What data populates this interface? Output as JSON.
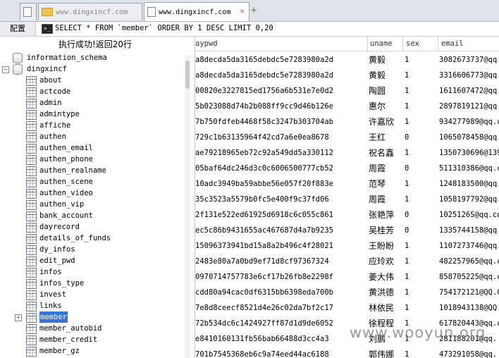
{
  "tabs": [
    {
      "label": "www.dingxincf.com",
      "active": false
    },
    {
      "label": "www.dingxincf.com",
      "active": true
    }
  ],
  "toolbar": {
    "config_label": "配置",
    "sql": "SELECT * FROM `member` ORDER BY 1 DESC LIMIT 0,20"
  },
  "left_panel": {
    "status": "执行成功!返回20行",
    "databases": [
      "information_schema",
      "dingxincf"
    ],
    "tables": [
      "about",
      "actcode",
      "admin",
      "admintype",
      "affiche",
      "authen",
      "authen_email",
      "authen_phone",
      "authen_realname",
      "authen_scene",
      "authen_video",
      "authen_vip",
      "bank_account",
      "dayrecord",
      "details_of_funds",
      "dy_infos",
      "edit_pwd",
      "infos",
      "infos_type",
      "invest",
      "links",
      "member",
      "member_autobid",
      "member_credit",
      "member_gz"
    ],
    "selected_table": "member"
  },
  "grid": {
    "columns": [
      "aypwd",
      "uname",
      "sex",
      "email"
    ],
    "rows": [
      {
        "pwd": "a8decda5da3165debdc5e7283980a2d",
        "uname": "黄毅",
        "sex": "1",
        "email": "3082673737@qq."
      },
      {
        "pwd": "a8decda5da3165debdc5e7283980a2d",
        "uname": "黄毅",
        "sex": "1",
        "email": "3316606773@qq."
      },
      {
        "pwd": "00820e3227815ed1756a6b531e7e0d2",
        "uname": "陶圆",
        "sex": "1",
        "email": "1611607472@qq."
      },
      {
        "pwd": "5b023088d74b2b088ff9cc9d46b126e",
        "uname": "惠尔",
        "sex": "1",
        "email": "2897819121@qq.c"
      },
      {
        "pwd": "7b750fdfeb4468f58c3247b303704ab",
        "uname": "许嘉欣",
        "sex": "1",
        "email": "934277989@qq.c"
      },
      {
        "pwd": "729c1b63135964f42cd7a6e0ea8678",
        "uname": "王红",
        "sex": "0",
        "email": "1065078458@qq."
      },
      {
        "pwd": "ae79218965eb72c92a549dd5a330112",
        "uname": "祝名鑫",
        "sex": "1",
        "email": "1350730696@139"
      },
      {
        "pwd": "05baf64dc246d3c0c6006500777cb52",
        "uname": "周霞",
        "sex": "0",
        "email": "511310386@qq.c"
      },
      {
        "pwd": "10adc3949ba59abbe56e057f20f883e",
        "uname": "范琴",
        "sex": "1",
        "email": "1248183500@qq."
      },
      {
        "pwd": "35c3523a5579b0fc5e400f9c37fd06",
        "uname": "周霞",
        "sex": "1",
        "email": "1058197792@qq."
      },
      {
        "pwd": "2f131e522ed61925d6918c6c055c861",
        "uname": "张艳萍",
        "sex": "0",
        "email": "1025126S@qq.com"
      },
      {
        "pwd": "ec5c86b9431655ac467687d4a7b9235",
        "uname": "吴桂芳",
        "sex": "0",
        "email": "1335744158@qq."
      },
      {
        "pwd": "15096373941bd15a8a2b496c4f28021",
        "uname": "王盼盼",
        "sex": "1",
        "email": "1107273746@qq."
      },
      {
        "pwd": "2483e80a7a0bd9ef71d8cf97367324",
        "uname": "应玲欢",
        "sex": "1",
        "email": "482257965@qq.c"
      },
      {
        "pwd": "0970714757783e6cf17b26fb8e2298f",
        "uname": "姜大伟",
        "sex": "1",
        "email": "858705225@qq.c"
      },
      {
        "pwd": "cdd80a94cac0df6315bb6398eda700b",
        "uname": "黄洪德",
        "sex": "1",
        "email": "754172121@QQ.C"
      },
      {
        "pwd": "7e8d8ceecf8521d4e26c02da7bf2c17",
        "uname": "林依民",
        "sex": "1",
        "email": "1018943138@QQ.("
      },
      {
        "pwd": "72b534dc6c1424927ff87d1d9de6052",
        "uname": "徐程程",
        "sex": "1",
        "email": "617820443@qq.c"
      },
      {
        "pwd": "e8410160131fb56bab66488d3cc4a3",
        "uname": "刘鹏",
        "sex": "1",
        "email": "281188201@qq."
      },
      {
        "pwd": "701b7545368eb6c9a74eed44ac6188",
        "uname": "郭伟娜",
        "sex": "1",
        "email": "473291058@qq."
      }
    ]
  },
  "watermark": "www.wooyun.org",
  "icons": {
    "folder": "folder-icon",
    "page": "page-icon",
    "terminal": "terminal-icon",
    "database": "database-icon",
    "table": "table-icon"
  }
}
